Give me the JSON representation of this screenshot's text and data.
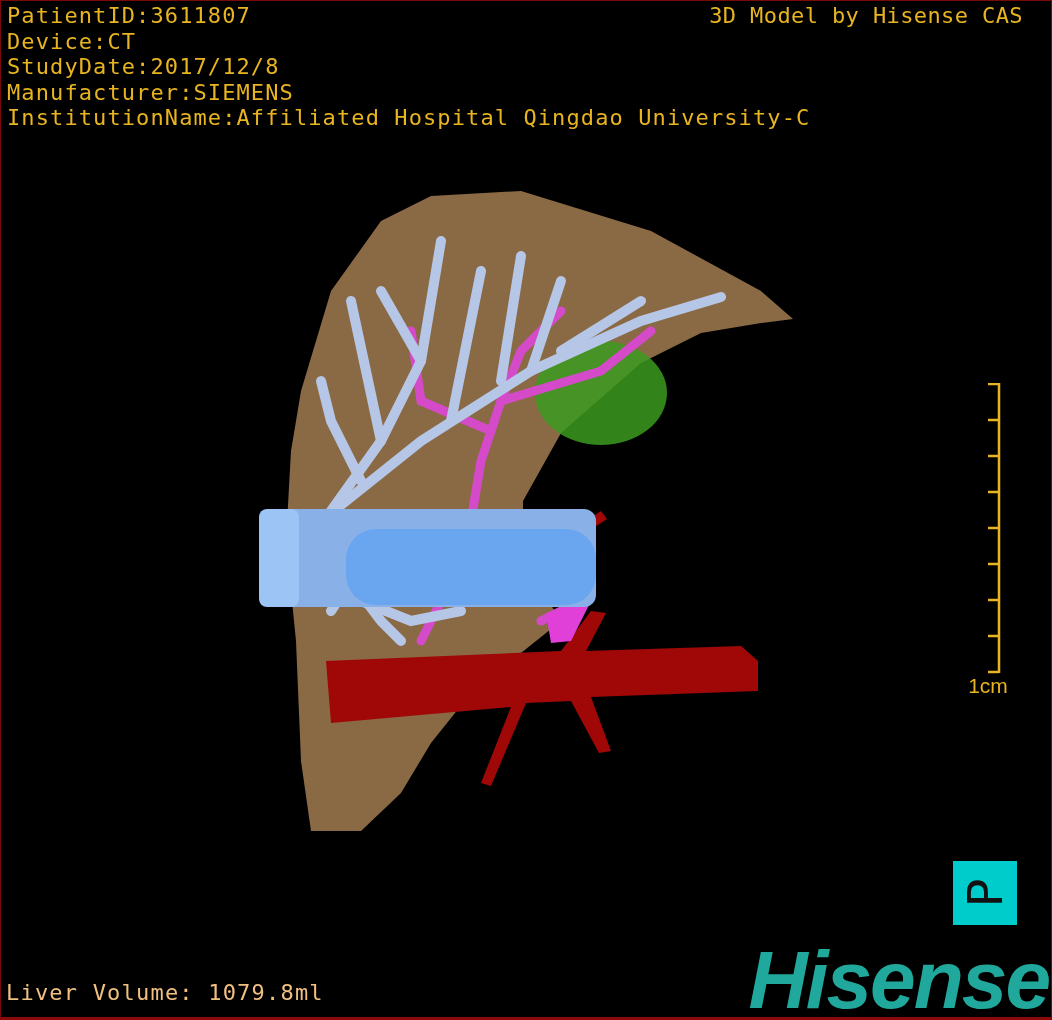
{
  "patient_info": [
    "PatientID:3611807",
    "Device:CT",
    "StudyDate:2017/12/8",
    "Manufacturer:SIEMENS",
    "InstitutionName:Affiliated Hospital Qingdao University-C"
  ],
  "credit": "3D Model by Hisense CAS",
  "scale_bar": {
    "label": "1cm"
  },
  "orientation_marker": "P",
  "liver_volume": "Liver Volume: 1079.8ml",
  "logo": "Hisense"
}
